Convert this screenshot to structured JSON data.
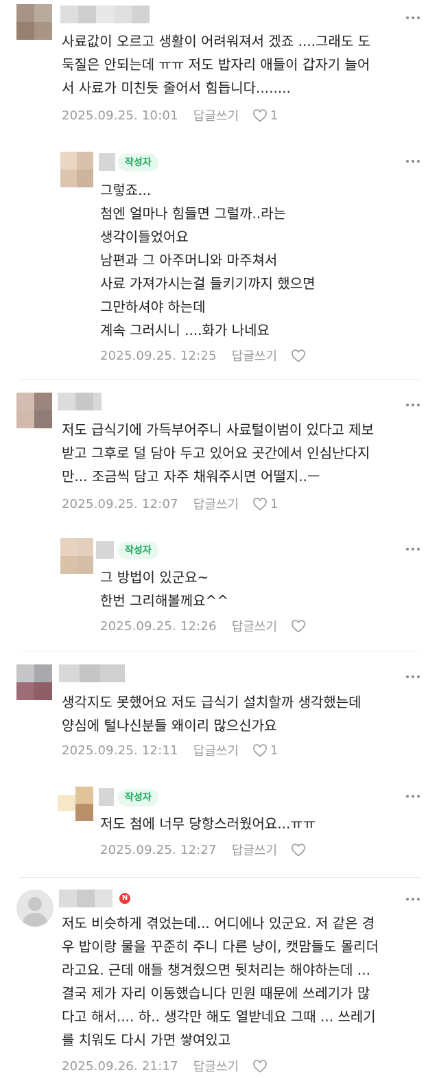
{
  "author_badge": "작성자",
  "reply_label": "답글쓰기",
  "colors": {
    "author_badge_bg": "#e7f8ee",
    "author_badge_text": "#17a85a",
    "new_badge": "#ee3a3a",
    "meta_text": "#9a9a9a"
  },
  "icons": {
    "more": "more-dots-icon",
    "like": "heart-outline-icon",
    "new": "new-badge-icon",
    "default_avatar": "default-avatar-icon"
  },
  "comments": [
    {
      "text": "사료값이 오르고 생활이 어려워져서 겠죠 ....그래도 도\n둑질은 안되는데 ㅠㅠ 저도 밥자리 애들이 갑자기 늘어\n서 사료가 미친듯 줄어서 힘듭니다........",
      "date": "2025.09.25. 10:01",
      "likes": "1"
    },
    {
      "text": "그렇죠...\n첨엔 얼마나 힘들면 그럴까..라는\n생각이들었어요\n남편과 그 아주머니와 마주쳐서\n사료 가져가시는걸 들키기까지 했으면\n그만하셔야 하는데\n계속 그러시니 ....화가 나네요",
      "date": "2025.09.25. 12:25",
      "likes": ""
    },
    {
      "text": "저도 급식기에 가득부어주니 사료털이범이 있다고 제보\n받고 그후로 덜 담아 두고 있어요 곳간에서 인심난다지\n만... 조금씩 담고 자주 채워주시면 어떨지..ㅡ",
      "date": "2025.09.25. 12:07",
      "likes": "1"
    },
    {
      "text": "그 방법이 있군요~\n한번 그리해볼께요^^",
      "date": "2025.09.25. 12:26",
      "likes": ""
    },
    {
      "text": "생각지도 못했어요 저도 급식기 설치할까 생각했는데\n양심에 털나신분들 왜이리 많으신가요",
      "date": "2025.09.25. 12:11",
      "likes": "1"
    },
    {
      "text": "저도 첨에 너무 당항스러웠어요...ㅠㅠ",
      "date": "2025.09.25. 12:27",
      "likes": ""
    },
    {
      "text": "저도 비슷하게 겪었는데... 어디에나 있군요. 저 같은 경\n우 밥이랑 물을 꾸준히 주니 다른 냥이, 캣맘들도 몰리더\n라고요. 근데 애들 챙겨줬으면 뒷처리는 해야하는데 ...\n결국 제가 자리 이동했습니다 민원 때문에 쓰레기가 많\n다고 해서.... 하.. 생각만 해도 열받네요 그때 ... 쓰레기\n를 치워도 다시 가면 쌓여있고",
      "date": "2025.09.26. 21:17",
      "likes": ""
    }
  ]
}
